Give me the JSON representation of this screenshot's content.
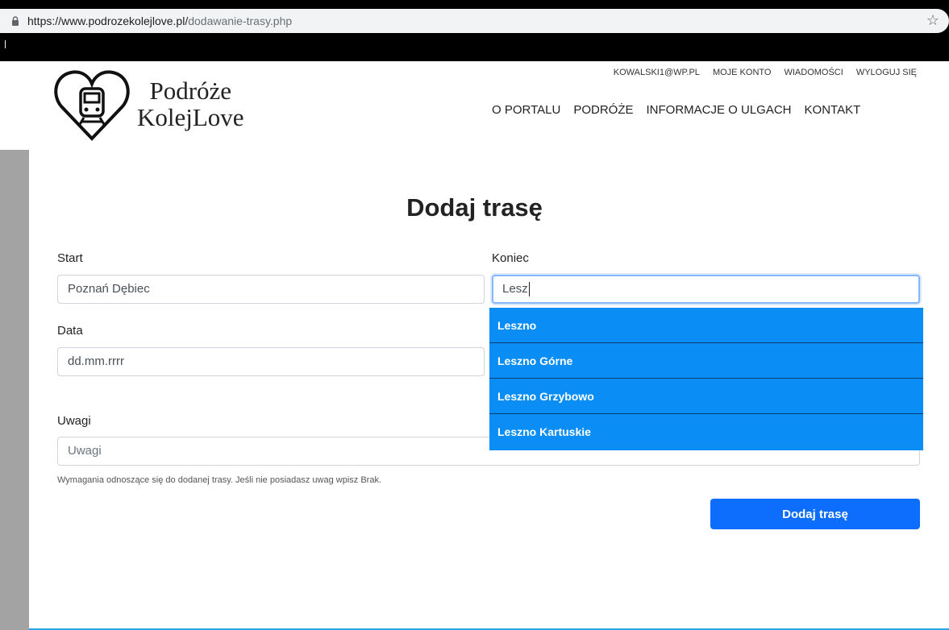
{
  "browser": {
    "url_domain": "https://www.podrozekolejlove.pl/",
    "url_path": "dodawanie-trasy.php"
  },
  "header": {
    "brand_line1": "Podróże",
    "brand_line2": "KolejLove",
    "top_nav": [
      "KOWALSKI1@WP.PL",
      "MOJE KONTO",
      "WIADOMOŚCI",
      "WYLOGUJ SIĘ"
    ],
    "main_nav": [
      "O PORTALU",
      "PODRÓŻE",
      "INFORMACJE O ULGACH",
      "KONTAKT"
    ]
  },
  "form": {
    "title": "Dodaj trasę",
    "start_label": "Start",
    "start_value": "Poznań Dębiec",
    "end_label": "Koniec",
    "end_value": "Lesz",
    "date_label": "Data",
    "date_placeholder": "dd.mm.rrrr",
    "notes_label": "Uwagi",
    "notes_placeholder": "Uwagi",
    "notes_help": "Wymagania odnoszące się do dodanej trasy. Jeśli nie posiadasz uwag wpisz Brak.",
    "submit_label": "Dodaj trasę",
    "suggestions": [
      "Leszno",
      "Leszno Górne",
      "Leszno Grzybowo",
      "Leszno Kartuskie"
    ]
  },
  "colors": {
    "accent": "#0d6efd",
    "dropdown": "#0a8ef6",
    "sidebar": "#a3a3a3"
  }
}
